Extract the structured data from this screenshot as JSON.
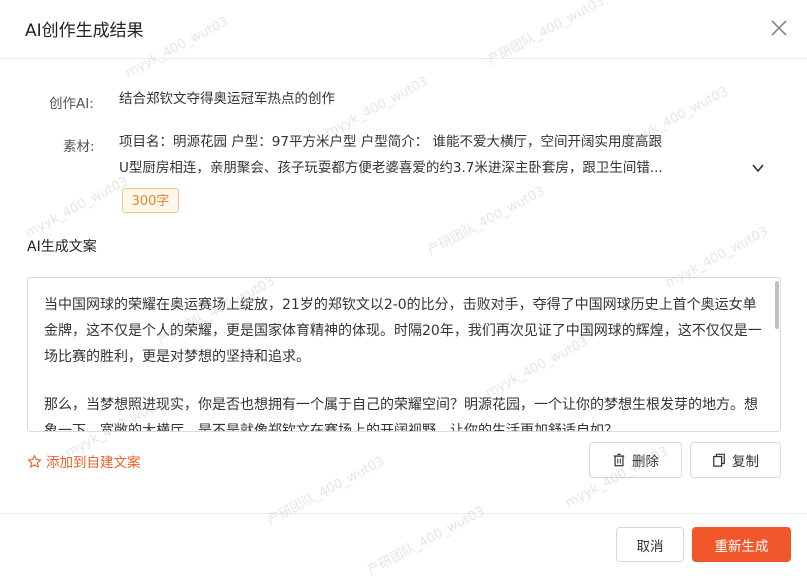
{
  "dialog": {
    "title": "AI创作生成结果"
  },
  "info": {
    "ai_label": "创作AI:",
    "ai_value": "结合郑钦文夺得奥运冠军热点的创作",
    "material_label": "素材:",
    "material_line1": "项目名：明源花园 户型：97平方米户型 户型简介： 谁能不爱大横厅，空间开阔实用度高跟",
    "material_line2": "U型厨房相连，亲朋聚会、孩子玩耍都方便老婆喜爱的约3.7米进深主卧套房，跟卫生间错...",
    "word_count_tag": "300字"
  },
  "section": {
    "title": "AI生成文案"
  },
  "content": {
    "paragraph1": "当中国网球的荣耀在奥运赛场上绽放，21岁的郑钦文以2-0的比分，击败对手，夺得了中国网球历史上首个奥运女单金牌，这不仅是个人的荣耀，更是国家体育精神的体现。时隔20年，我们再次见证了中国网球的辉煌，这不仅仅是一场比赛的胜利，更是对梦想的坚持和追求。",
    "paragraph2": "那么，当梦想照进现实，你是否也想拥有一个属于自己的荣耀空间？明源花园，一个让你的梦想生根发芽的地方。想象一下，宽敞的大横厅，是不是就像郑钦文在赛场上的开阔视野，让你的生活更加舒适自如？"
  },
  "actions": {
    "add_link": "添加到自建文案",
    "delete_label": "删除",
    "copy_label": "复制",
    "cancel_label": "取消",
    "regenerate_label": "重新生成"
  },
  "watermark": {
    "text1": "myyk_400_wut03",
    "text2": "产研团队_400_wut03"
  },
  "colors": {
    "accent": "#f0582c",
    "tag_text": "#e8832a",
    "tag_border": "#f3c58a"
  }
}
